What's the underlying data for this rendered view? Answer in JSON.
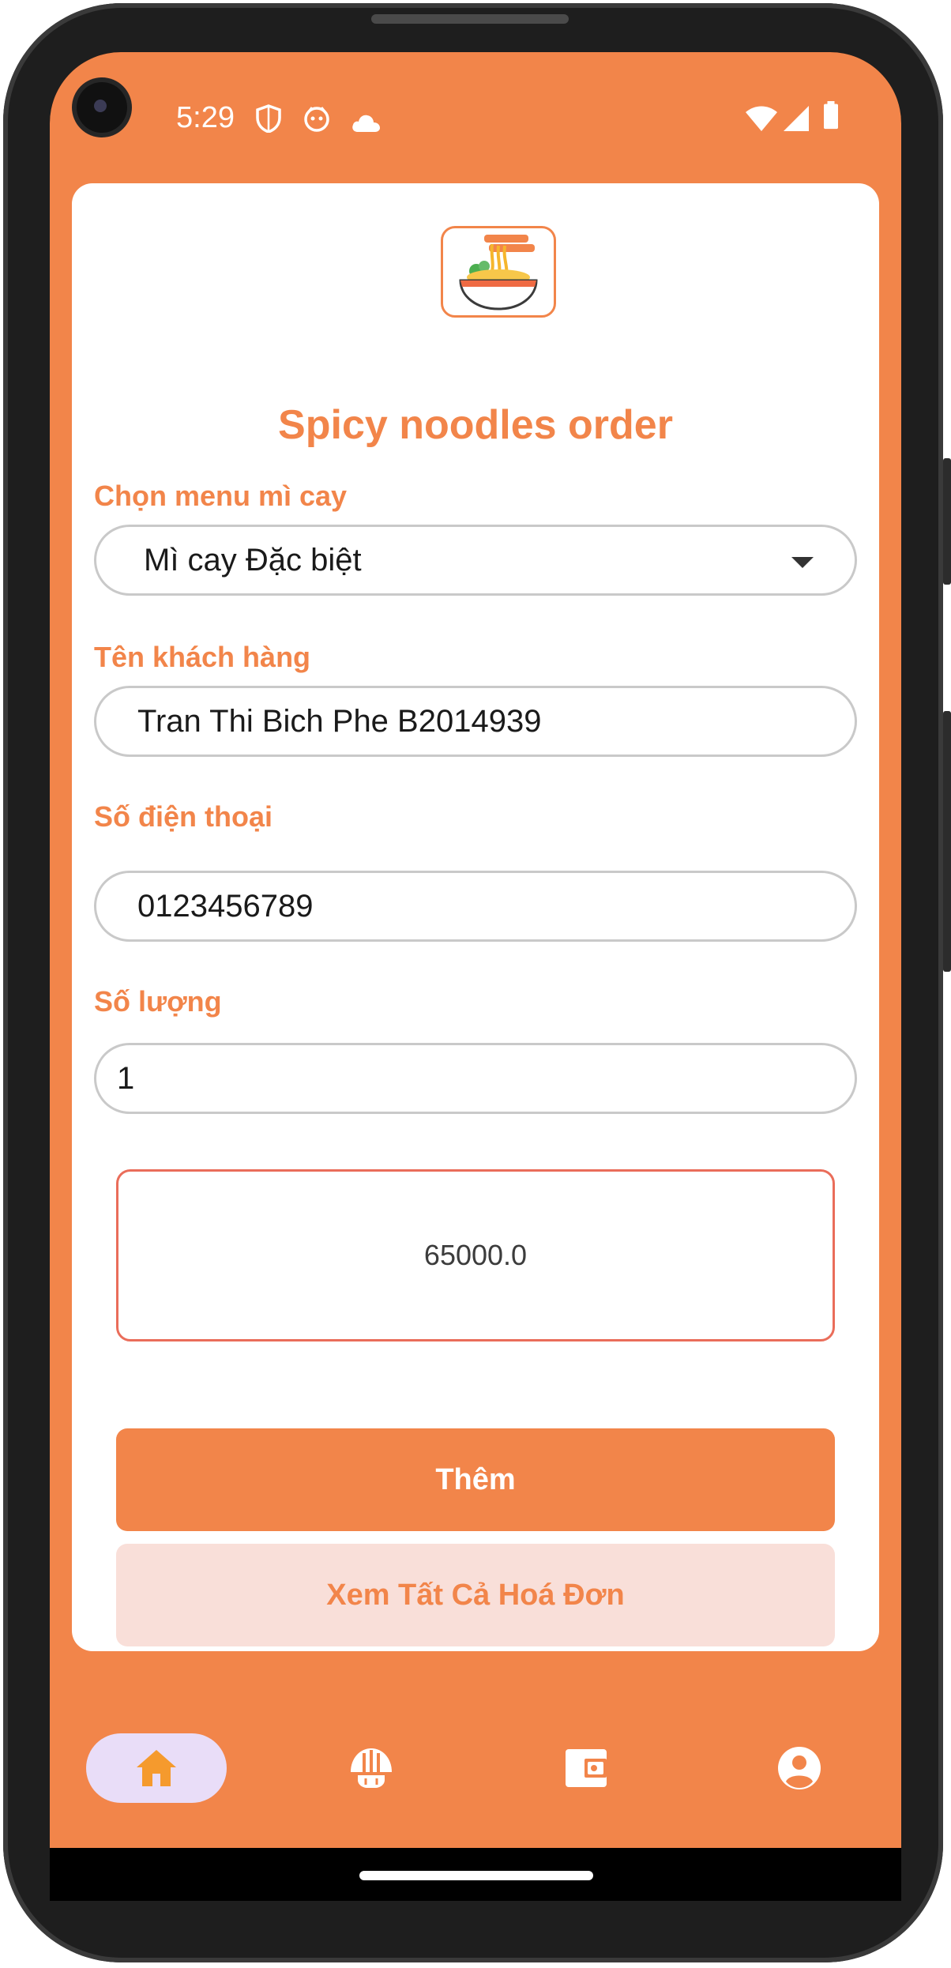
{
  "status_bar": {
    "time": "5:29",
    "left_icons": [
      "shield-icon",
      "face-icon",
      "cloud-icon"
    ],
    "right_icons": [
      "wifi-icon",
      "signal-icon",
      "battery-icon"
    ]
  },
  "header": {
    "logo": "noodle-bowl-icon",
    "title": "Spicy noodles order"
  },
  "form": {
    "menu_label": "Chọn menu mì cay",
    "menu_value": "Mì cay Đặc biệt",
    "customer_label": "Tên khách hàng",
    "customer_value": "Tran Thi Bich Phe B2014939",
    "phone_label": "Số điện thoại",
    "phone_value": "0123456789",
    "quantity_label": "Số lượng",
    "quantity_value": "1",
    "total_value": "65000.0"
  },
  "actions": {
    "add_label": "Thêm",
    "view_all_label": "Xem Tất Cả Hoá Đơn"
  },
  "bottom_nav": {
    "items": [
      {
        "icon": "home-icon",
        "active": true
      },
      {
        "icon": "noodle-dome-icon",
        "active": false
      },
      {
        "icon": "wallet-icon",
        "active": false
      },
      {
        "icon": "account-icon",
        "active": false
      }
    ]
  },
  "colors": {
    "brand": "#f2854a",
    "price_border": "#ea6d5a",
    "secondary_button_bg": "#f9dfd9",
    "active_nav_bg": "#e9ddf8",
    "home_icon": "#f59a2d"
  }
}
